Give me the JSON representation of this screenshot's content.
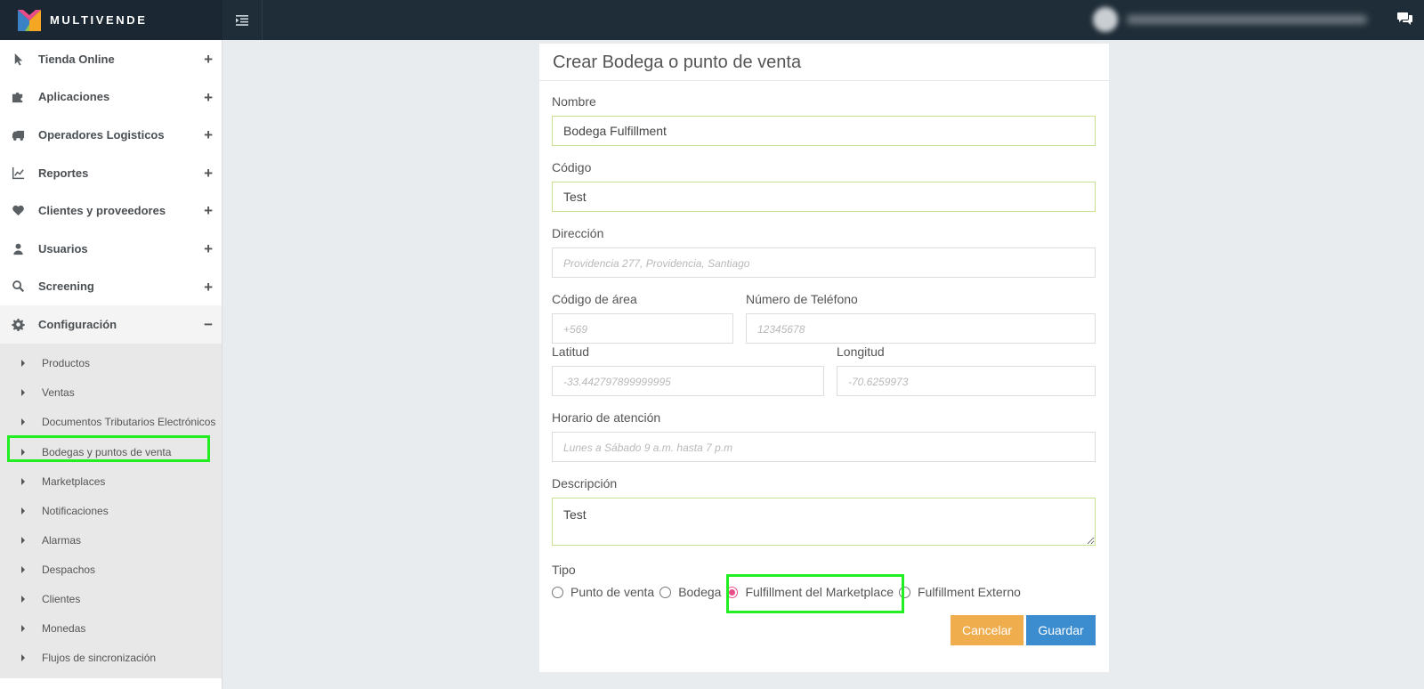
{
  "brand": {
    "name": "MULTIVENDE",
    "logo_icon": "multivende-logo-icon"
  },
  "topbar": {
    "menu_icon": "indent-menu-icon",
    "chat_icon": "comments-icon"
  },
  "sidebar": {
    "items": [
      {
        "label": "Tienda Online",
        "icon": "pointer-icon",
        "sign": "+"
      },
      {
        "label": "Aplicaciones",
        "icon": "puzzle-icon",
        "sign": "+"
      },
      {
        "label": "Operadores Logisticos",
        "icon": "truck-icon",
        "sign": "+"
      },
      {
        "label": "Reportes",
        "icon": "line-chart-icon",
        "sign": "+"
      },
      {
        "label": "Clientes y proveedores",
        "icon": "heart-icon",
        "sign": "+"
      },
      {
        "label": "Usuarios",
        "icon": "user-icon",
        "sign": "+"
      },
      {
        "label": "Screening",
        "icon": "search-icon",
        "sign": "+"
      },
      {
        "label": "Configuración",
        "icon": "gear-icon",
        "sign": "−"
      }
    ],
    "subitems": [
      "Productos",
      "Ventas",
      "Documentos Tributarios Electrónicos",
      "Bodegas y puntos de venta",
      "Marketplaces",
      "Notificaciones",
      "Alarmas",
      "Despachos",
      "Clientes",
      "Monedas",
      "Flujos de sincronización"
    ]
  },
  "form": {
    "title": "Crear Bodega o punto de venta",
    "nombre": {
      "label": "Nombre",
      "value": "Bodega Fulfillment"
    },
    "codigo": {
      "label": "Código",
      "value": "Test"
    },
    "direccion": {
      "label": "Dirección",
      "placeholder": "Providencia 277, Providencia, Santiago"
    },
    "codigo_area": {
      "label": "Código de área",
      "placeholder": "+569"
    },
    "telefono": {
      "label": "Número de Teléfono",
      "placeholder": "12345678"
    },
    "latitud": {
      "label": "Latitud",
      "placeholder": "-33.442797899999995"
    },
    "longitud": {
      "label": "Longitud",
      "placeholder": "-70.6259973"
    },
    "horario": {
      "label": "Horario de atención",
      "placeholder": "Lunes a Sábado 9 a.m. hasta 7 p.m"
    },
    "descripcion": {
      "label": "Descripción",
      "value": "Test"
    },
    "tipo": {
      "label": "Tipo",
      "options": [
        "Punto de venta",
        "Bodega",
        "Fulfillment del Marketplace",
        "Fulfillment Externo"
      ],
      "selected": "Fulfillment del Marketplace"
    },
    "cancel_label": "Cancelar",
    "save_label": "Guardar"
  }
}
